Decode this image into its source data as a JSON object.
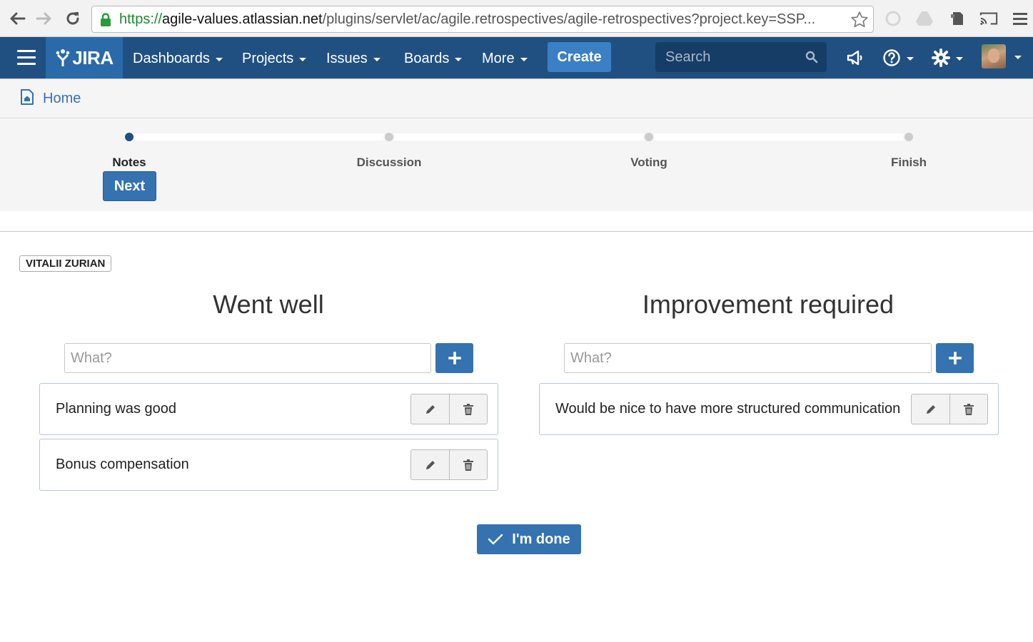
{
  "browser": {
    "url_protocol": "https://",
    "url_host": "agile-values.atlassian.net",
    "url_path": "/plugins/servlet/ac/agile.retrospectives/agile-retrospectives?project.key=SSP..."
  },
  "header": {
    "logo_text": "JIRA",
    "menu": [
      "Dashboards",
      "Projects",
      "Issues",
      "Boards",
      "More"
    ],
    "create_label": "Create",
    "search_placeholder": "Search"
  },
  "breadcrumb": {
    "home_label": "Home"
  },
  "stepper": {
    "steps": [
      "Notes",
      "Discussion",
      "Voting",
      "Finish"
    ],
    "active_index": 0,
    "next_label": "Next"
  },
  "user_tag": "VITALII ZURIAN",
  "columns": [
    {
      "title": "Went well",
      "input_placeholder": "What?",
      "notes": [
        "Planning was good",
        "Bonus compensation"
      ]
    },
    {
      "title": "Improvement required",
      "input_placeholder": "What?",
      "notes": [
        "Would be nice to have more structured communication"
      ]
    }
  ],
  "done_label": "I'm done",
  "colors": {
    "header_bg": "#205081",
    "primary": "#3572b0",
    "create": "#3b7fc4"
  }
}
